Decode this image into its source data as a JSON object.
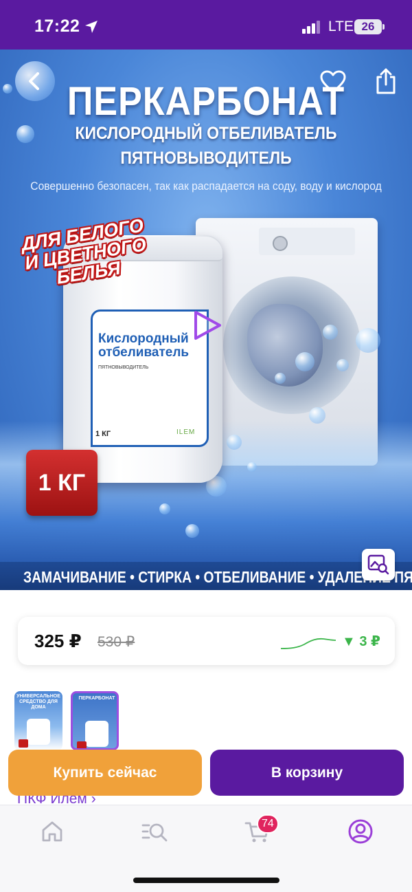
{
  "status_bar": {
    "time": "17:22",
    "network": "LTE",
    "battery": "26"
  },
  "hero": {
    "title": "ПЕРКАРБОНАТ",
    "subtitle_line1": "КИСЛОРОДНЫЙ ОТБЕЛИВАТЕЛЬ",
    "subtitle_line2": "ПЯТНОВЫВОДИТЕЛЬ",
    "tagline": "Совершенно безопасен, так как распадается на соду, воду и кислород",
    "promo_badge": "ДЛЯ БЕЛОГО И ЦВЕТНОГО БЕЛЬЯ",
    "jar_title": "Кислородный отбеливатель",
    "jar_subtitle": "ПЯТНОВЫВОДИТЕЛЬ",
    "jar_weight": "1 КГ",
    "jar_brand": "ILEM",
    "weight_badge": "1 КГ",
    "footer_text": "ЗАМАЧИВАНИЕ  • СТИРКА •  ОТБЕЛИВАНИЕ  •  УДАЛЕНИЕ ПЯТЕН"
  },
  "price": {
    "current": "325 ₽",
    "old": "530 ₽",
    "drop": "▼ 3 ₽",
    "trend_color": "#3bb54a"
  },
  "thumbnails": [
    {
      "caption": "УНИВЕРСАЛЬНОЕ СРЕДСТВО ДЛЯ ДОМА"
    },
    {
      "caption": "ПЕРКАРБОНАТ"
    }
  ],
  "seller": {
    "name": "ПКФ Илем ›"
  },
  "actions": {
    "buy_now": "Купить сейчас",
    "add_to_cart": "В корзину"
  },
  "tabbar": {
    "cart_count": "74",
    "active_tab": "profile",
    "icons": [
      "home-icon",
      "catalog-search-icon",
      "cart-icon",
      "profile-icon"
    ]
  },
  "colors": {
    "brand_purple": "#5a1aa0",
    "buy_orange": "#f0a13a",
    "badge_pink": "#e0245e",
    "price_drop_green": "#3bb54a"
  }
}
